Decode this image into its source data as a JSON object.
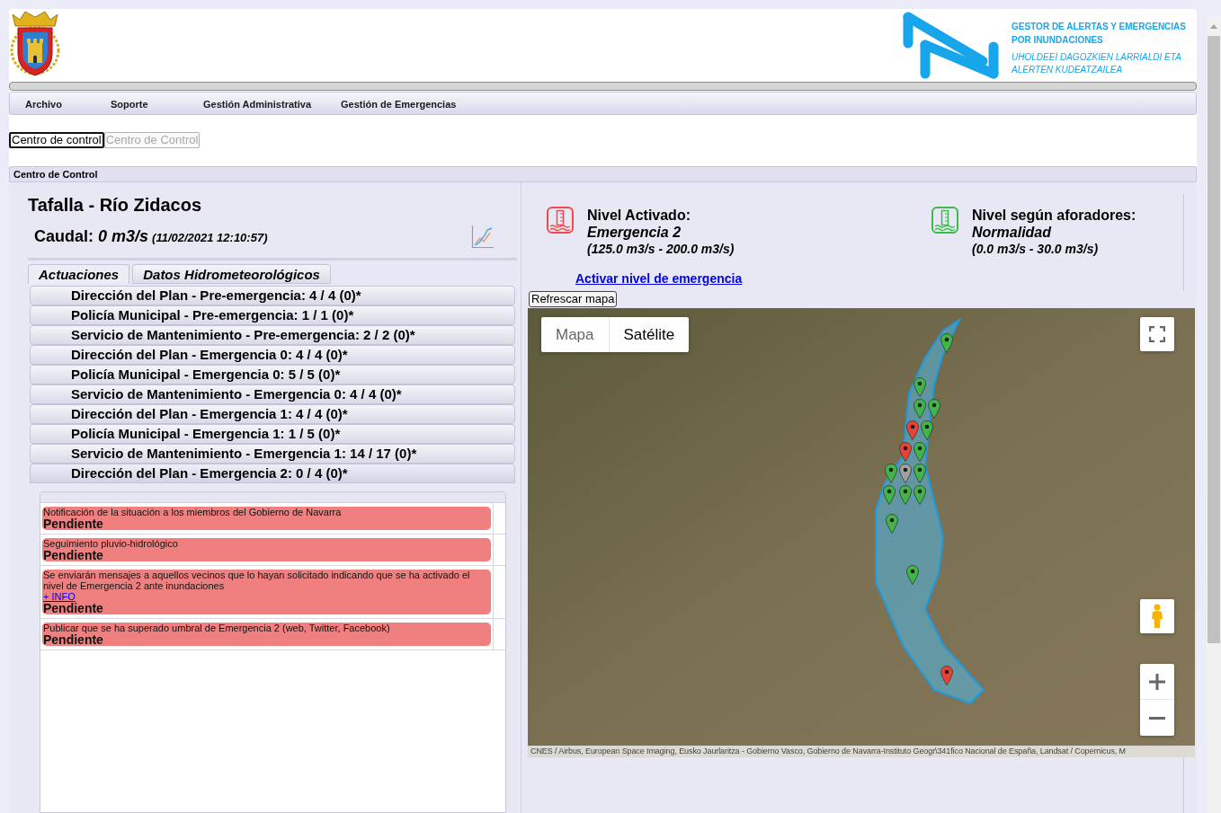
{
  "header": {
    "logo_title": [
      "GESTOR DE ALERTAS Y EMERGENCIAS",
      "POR INUNDACIONES"
    ],
    "logo_subtitle": [
      "UHOLDEEI DAGOZKIEN LARRIALDI ETA",
      "ALERTEN KUDEATZAILEA"
    ]
  },
  "menu": [
    "Archivo",
    "Soporte",
    "Gestión Administrativa",
    "Gestión de Emergencias"
  ],
  "view_buttons": [
    {
      "label": "Centro de control",
      "disabled": false
    },
    {
      "label": "Centro de Control",
      "disabled": true
    }
  ],
  "section_title": "Centro de Control",
  "station": {
    "title": "Tafalla - Río Zidacos",
    "flow_label": "Caudal:",
    "flow_value": "0 m3/s",
    "flow_time": "(11/02/2021 12:10:57)"
  },
  "tabs": [
    {
      "label": "Actuaciones",
      "selected": true
    },
    {
      "label": "Datos Hidrometeorológicos",
      "selected": false
    }
  ],
  "action_groups": [
    {
      "label": "Dirección del Plan - Pre-emergencia: 4 / 4 (0)*",
      "expanded": false
    },
    {
      "label": "Policía Municipal - Pre-emergencia: 1 / 1 (0)*",
      "expanded": false
    },
    {
      "label": "Servicio de Mantenimiento - Pre-emergencia: 2 / 2 (0)*",
      "expanded": false
    },
    {
      "label": "Dirección del Plan - Emergencia 0: 4 / 4 (0)*",
      "expanded": false
    },
    {
      "label": "Policía Municipal - Emergencia 0: 5 / 5 (0)*",
      "expanded": false
    },
    {
      "label": "Servicio de Mantenimiento - Emergencia 0: 4 / 4 (0)*",
      "expanded": false
    },
    {
      "label": "Dirección del Plan - Emergencia 1: 4 / 4 (0)*",
      "expanded": false
    },
    {
      "label": "Policía Municipal - Emergencia 1: 1 / 5 (0)*",
      "expanded": false
    },
    {
      "label": "Servicio de Mantenimiento - Emergencia 1: 14 / 17 (0)*",
      "expanded": false
    },
    {
      "label": "Dirección del Plan - Emergencia 2: 0 / 4 (0)*",
      "expanded": true,
      "tasks": [
        {
          "description": "Notificación de la situación a los miembros del Gobierno de Navarra",
          "status": "Pendiente"
        },
        {
          "description": "Seguimiento pluvio-hidrológico",
          "status": "Pendiente"
        },
        {
          "description": "Se enviarán mensajes a aquellos vecinos que lo hayan solicitado indicando que se ha activado el nivel de Emergencia 2 ante inundaciones",
          "link": "+ INFO",
          "status": "Pendiente"
        },
        {
          "description": "Publicar que se ha superado umbral de Emergencia 2 (web, Twitter, Facebook)",
          "status": "Pendiente"
        }
      ]
    }
  ],
  "levels": [
    {
      "label": "Nivel Activado:",
      "value": "Emergencia 2",
      "range": "(125.0 m3/s - 200.0 m3/s)",
      "color": "#ee4b50"
    },
    {
      "label": "Nivel según aforadores:",
      "value": "Normalidad",
      "range": "(0.0 m3/s - 30.0 m3/s)",
      "color": "#3dba4e"
    }
  ],
  "activate_link": "Activar nivel de emergencia",
  "map": {
    "refresh_button": "Refrescar mapa",
    "map_types": [
      {
        "label": "Mapa",
        "selected": false
      },
      {
        "label": "Satélite",
        "selected": true
      }
    ],
    "markers": [
      {
        "color": "#42b549"
      },
      {
        "color": "#42b549"
      },
      {
        "color": "#42b549"
      },
      {
        "color": "#42b549"
      },
      {
        "color": "#42b549"
      },
      {
        "color": "#ea4335"
      },
      {
        "color": "#42b549"
      },
      {
        "color": "#ea4335"
      },
      {
        "color": "#42b549"
      },
      {
        "color": "#42b549"
      },
      {
        "color": "#a0a0a0"
      },
      {
        "color": "#42b549"
      },
      {
        "color": "#42b549"
      },
      {
        "color": "#42b549"
      },
      {
        "color": "#42b549"
      },
      {
        "color": "#42b549"
      },
      {
        "color": "#ea4335"
      }
    ],
    "attribution": "CNES / Airbus, European Space Imaging, Eusko Jaurlaritza - Gobierno Vasco, Gobierno de Navarra-Instituto Geogr\\341fico Nacional de España, Landsat / Copernicus, M"
  }
}
